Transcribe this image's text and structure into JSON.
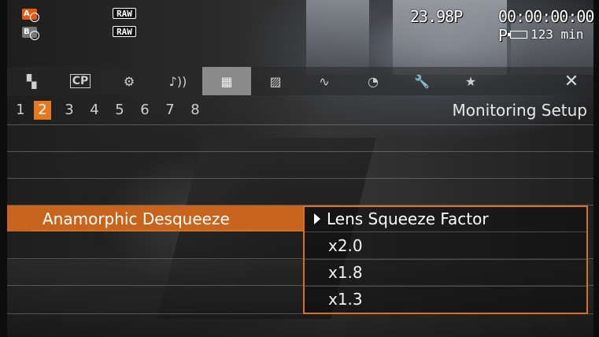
{
  "status": {
    "left_badges": [
      {
        "label": "A",
        "color": "#e05a12"
      },
      {
        "label": "B",
        "color": "#777777"
      }
    ],
    "raw_labels": [
      "RAW",
      "RAW"
    ],
    "frame_rate": "23.98P",
    "timecode": "00:00:00:00 P",
    "battery_icon": "battery-icon",
    "remaining": "123 min"
  },
  "tabs": [
    {
      "icon": "camera-icon",
      "glyph": "▚",
      "active": false
    },
    {
      "icon": "cp-icon",
      "glyph": "CP",
      "active": false
    },
    {
      "icon": "camera-setup-icon",
      "glyph": "⚙",
      "active": false
    },
    {
      "icon": "audio-icon",
      "glyph": "♪))",
      "active": false
    },
    {
      "icon": "monitoring-icon",
      "glyph": "▦",
      "active": true
    },
    {
      "icon": "recording-icon",
      "glyph": "▨",
      "active": false
    },
    {
      "icon": "waveform-icon",
      "glyph": "∿",
      "active": false
    },
    {
      "icon": "assign-icon",
      "glyph": "◔",
      "active": false
    },
    {
      "icon": "system-wrench-icon",
      "glyph": "🔧",
      "active": false
    },
    {
      "icon": "star-icon",
      "glyph": "★",
      "active": false
    }
  ],
  "close_glyph": "✕",
  "pages": [
    "1",
    "2",
    "3",
    "4",
    "5",
    "6",
    "7",
    "8"
  ],
  "active_page": "2",
  "page_title": "Monitoring Setup",
  "menu_item": "Anamorphic Desqueeze",
  "popup": {
    "header": "Lens Squeeze Factor",
    "options": [
      "x2.0",
      "x1.8",
      "x1.3"
    ]
  },
  "colors": {
    "accent": "#d8701f",
    "selected_row": "#c8641b"
  }
}
